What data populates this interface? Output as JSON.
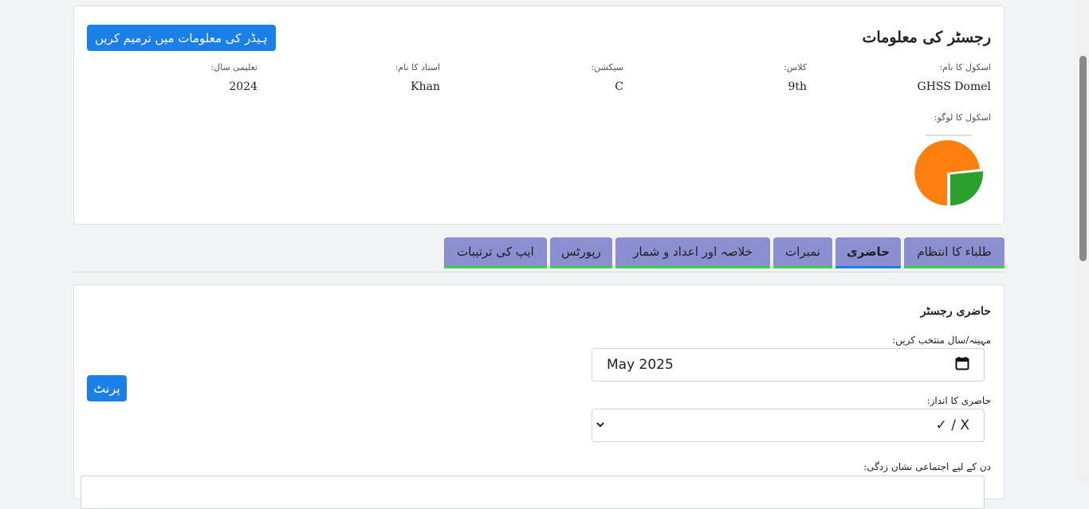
{
  "header": {
    "title": "رجسٹر کی معلومات",
    "edit_button": "ہیڈر کی معلومات میں ترمیم کریں",
    "fields": [
      {
        "label": "اسکول کا نام:",
        "value": "GHSS Domel"
      },
      {
        "label": "کلاس:",
        "value": "9th"
      },
      {
        "label": "سیکشن:",
        "value": "C"
      },
      {
        "label": "استاد کا نام:",
        "value": "Khan"
      },
      {
        "label": "تعلیمی سال:",
        "value": "2024"
      }
    ],
    "logo_label": "اسکول کا لوگو:",
    "logo_colors": {
      "orange": "#ff7f0e",
      "green": "#2ca02c"
    }
  },
  "tabs": [
    {
      "label": "طلباء کا انتظام",
      "active": false
    },
    {
      "label": "حاضری",
      "active": true
    },
    {
      "label": "نمبرات",
      "active": false
    },
    {
      "label": "خلاصہ اور اعداد و شمار",
      "active": false
    },
    {
      "label": "رپورٹس",
      "active": false
    },
    {
      "label": "ایپ کی ترتیبات",
      "active": false
    }
  ],
  "attendance": {
    "title": "حاضری رجسٹر",
    "month_label": "مہینہ/سال منتخب کریں:",
    "month_value": "May 2025",
    "style_label": "حاضری کا انداز:",
    "style_value": "✓ / X",
    "print_button": "پرنٹ",
    "collective_label": "دن کے لیے اجتماعی نشان زدگی:"
  },
  "colors": {
    "primary": "#1a7fe6",
    "tab_bg": "#8c8fcf",
    "tab_border": "#3ccf4a"
  }
}
